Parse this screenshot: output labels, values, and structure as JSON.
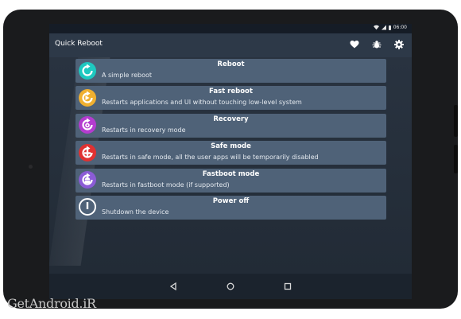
{
  "statusbar": {
    "time": "06:00"
  },
  "appbar": {
    "title": "Quick Reboot"
  },
  "icons": {
    "favorite": "heart-icon",
    "debug": "bug-icon",
    "settings": "gear-icon",
    "back": "back-triangle-icon",
    "home": "home-circle-icon",
    "recents": "recents-square-icon"
  },
  "colors": {
    "reboot": "#1ec8c0",
    "fast_reboot": "#f0b030",
    "recovery": "#b43ccf",
    "safe_mode": "#e03131",
    "fastboot": "#8b5cd6",
    "power_off": "#ffffff",
    "item_bg": "#4f6278"
  },
  "options": [
    {
      "title": "Reboot",
      "desc": "A simple reboot"
    },
    {
      "title": "Fast reboot",
      "desc": "Restarts applications and UI without touching low-level system"
    },
    {
      "title": "Recovery",
      "desc": "Restarts in recovery mode"
    },
    {
      "title": "Safe mode",
      "desc": "Restarts in safe mode, all the user apps will be temporarily disabled"
    },
    {
      "title": "Fastboot mode",
      "desc": "Restarts in fastboot mode (if supported)"
    },
    {
      "title": "Power off",
      "desc": "Shutdown the device"
    }
  ],
  "watermark": "GetAndroid.iR"
}
